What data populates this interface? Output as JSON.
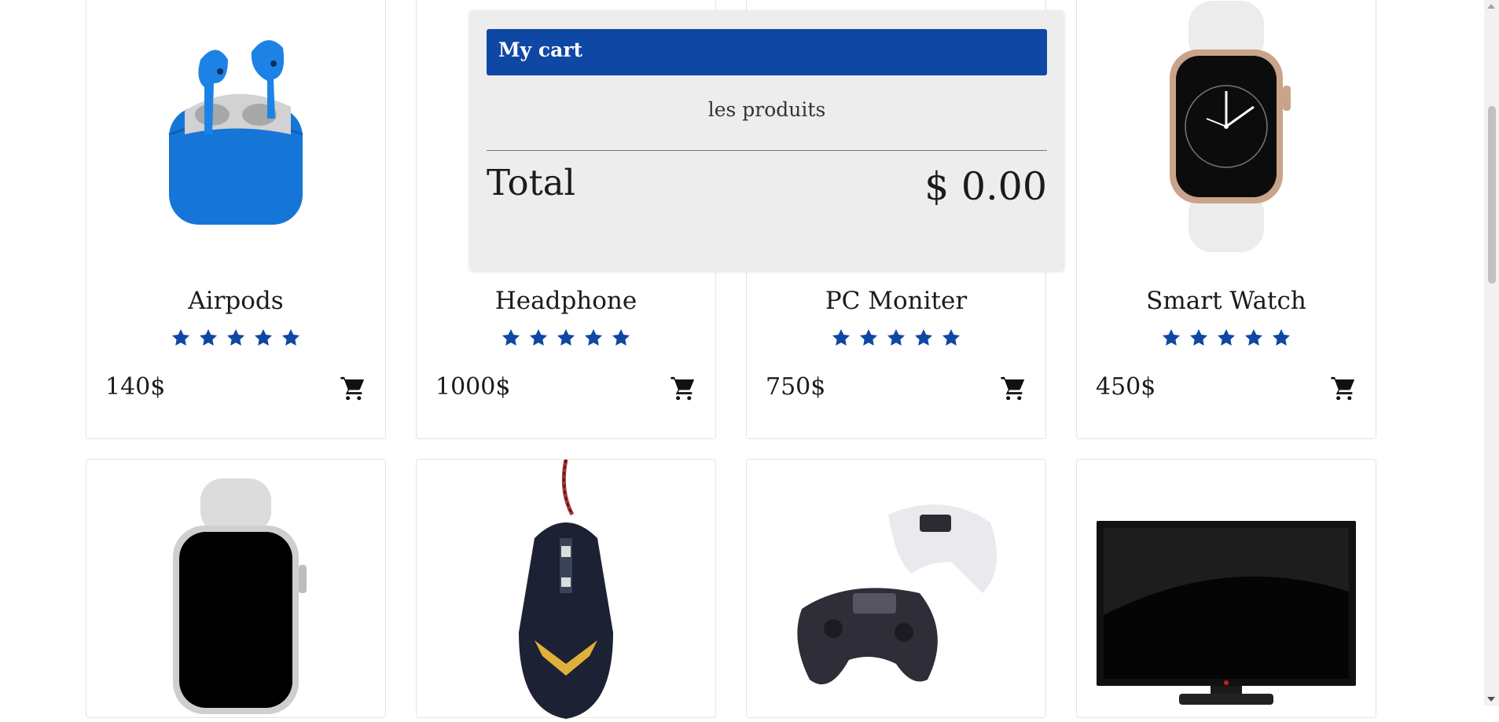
{
  "products_row1": [
    {
      "name": "Airpods",
      "price": "140$",
      "image": "airpods-image",
      "rating": 5
    },
    {
      "name": "Headphone",
      "price": "1000$",
      "image": "headphone-image",
      "rating": 5
    },
    {
      "name": "PC Moniter",
      "price": "750$",
      "image": "monitor-image",
      "rating": 5
    },
    {
      "name": "Smart Watch",
      "price": "450$",
      "image": "smartwatch-image",
      "rating": 5
    }
  ],
  "products_row2": [
    {
      "image": "smartwatch-white-image"
    },
    {
      "image": "gaming-mouse-image"
    },
    {
      "image": "game-controllers-image"
    },
    {
      "image": "television-image"
    }
  ],
  "cart": {
    "title": "My cart",
    "products_label": "les produits",
    "total_label": "Total",
    "total_value": "$ 0.00"
  },
  "icons": {
    "star": "star-icon",
    "cart": "shopping-cart-icon"
  },
  "colors": {
    "accent": "#0f47a5",
    "star": "#0f47a5",
    "panel_bg": "#ededed"
  }
}
